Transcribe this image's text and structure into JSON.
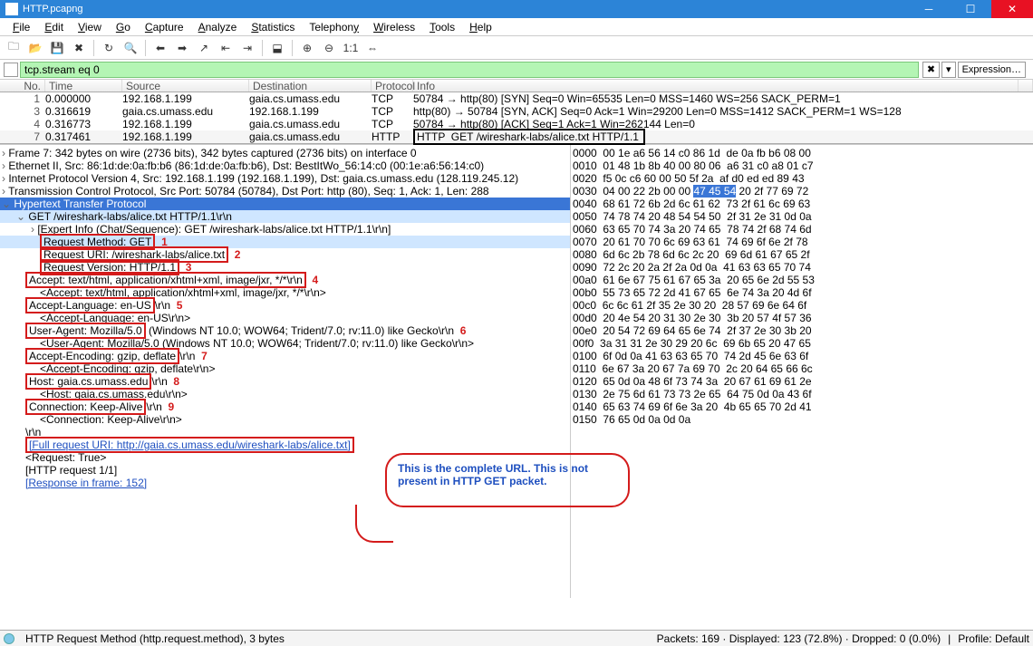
{
  "window": {
    "title": "HTTP.pcapng"
  },
  "menu": [
    "File",
    "Edit",
    "View",
    "Go",
    "Capture",
    "Analyze",
    "Statistics",
    "Telephony",
    "Wireless",
    "Tools",
    "Help"
  ],
  "filter": {
    "value": "tcp.stream eq 0",
    "expression_btn": "Expression…"
  },
  "columns": {
    "no": "No.",
    "time": "Time",
    "source": "Source",
    "dest": "Destination",
    "proto": "Protocol",
    "info": "Info"
  },
  "packets": [
    {
      "no": "1",
      "time": "0.000000",
      "src": "192.168.1.199",
      "dst": "gaia.cs.umass.edu",
      "proto": "TCP",
      "info": "50784 → http(80) [SYN] Seq=0 Win=65535 Len=0 MSS=1460 WS=256 SACK_PERM=1"
    },
    {
      "no": "3",
      "time": "0.316619",
      "src": "gaia.cs.umass.edu",
      "dst": "192.168.1.199",
      "proto": "TCP",
      "info": "http(80) → 50784 [SYN, ACK] Seq=0 Ack=1 Win=29200 Len=0 MSS=1412 SACK_PERM=1 WS=128"
    },
    {
      "no": "4",
      "time": "0.316773",
      "src": "192.168.1.199",
      "dst": "gaia.cs.umass.edu",
      "proto": "TCP",
      "info": "50784 → http(80) [ACK] Seq=1 Ack=1 Win=262144 Len=0"
    },
    {
      "no": "7",
      "time": "0.317461",
      "src": "192.168.1.199",
      "dst": "gaia.cs.umass.edu",
      "proto": "HTTP",
      "info": "GET /wireshark-labs/alice.txt HTTP/1.1 ",
      "boxed": true
    }
  ],
  "details": {
    "frame": "Frame 7: 342 bytes on wire (2736 bits), 342 bytes captured (2736 bits) on interface 0",
    "eth": "Ethernet II, Src: 86:1d:de:0a:fb:b6 (86:1d:de:0a:fb:b6), Dst: BestItWo_56:14:c0 (00:1e:a6:56:14:c0)",
    "ip": "Internet Protocol Version 4, Src: 192.168.1.199 (192.168.1.199), Dst: gaia.cs.umass.edu (128.119.245.12)",
    "tcp": "Transmission Control Protocol, Src Port: 50784 (50784), Dst Port: http (80), Seq: 1, Ack: 1, Len: 288",
    "http": "Hypertext Transfer Protocol",
    "get": "GET /wireshark-labs/alice.txt HTTP/1.1\\r\\n",
    "expert": "[Expert Info (Chat/Sequence): GET /wireshark-labs/alice.txt HTTP/1.1\\r\\n]",
    "method": "Request Method: GET",
    "uri": "Request URI: /wireshark-labs/alice.txt",
    "ver": "Request Version: HTTP/1.1",
    "accept": "Accept: text/html, application/xhtml+xml, image/jxr, */*\\r\\n",
    "accept_sub": "<Accept: text/html, application/xhtml+xml, image/jxr, */*\\r\\n>",
    "lang": "Accept-Language: en-US",
    "lang_tail": "\\r\\n",
    "lang_sub": "<Accept-Language: en-US\\r\\n>",
    "ua": "User-Agent: Mozilla/5.0",
    "ua_tail": " (Windows NT 10.0; WOW64; Trident/7.0; rv:11.0) like Gecko\\r\\n",
    "ua_sub": "<User-Agent: Mozilla/5.0 (Windows NT 10.0; WOW64; Trident/7.0; rv:11.0) like Gecko\\r\\n>",
    "enc": "Accept-Encoding: gzip, deflate",
    "enc_tail": "\\r\\n",
    "enc_sub": "<Accept-Encoding: gzip, deflate\\r\\n>",
    "host": "Host: gaia.cs.umass.edu",
    "host_tail": "\\r\\n",
    "host_sub": "<Host: gaia.cs.umass.edu\\r\\n>",
    "conn": "Connection: Keep-Alive",
    "conn_tail": "\\r\\n",
    "conn_sub": "<Connection: Keep-Alive\\r\\n>",
    "crlf": "\\r\\n",
    "full": "[Full request URI: http://gaia.cs.umass.edu/wireshark-labs/alice.txt]",
    "reqtrue": "<Request: True>",
    "req11": "[HTTP request 1/1]",
    "resp": "[Response in frame: 152]"
  },
  "annotations": {
    "n1": "1",
    "n2": "2",
    "n3": "3",
    "n4": "4",
    "n5": "5",
    "n6": "6",
    "n7": "7",
    "n8": "8",
    "n9": "9"
  },
  "callout": "This is the complete URL. This is not present in HTTP GET packet.",
  "hex": [
    "0000  00 1e a6 56 14 c0 86 1d  de 0a fb b6 08 00",
    "0010  01 48 1b 8b 40 00 80 06  a6 31 c0 a8 01 c7",
    "0020  f5 0c c6 60 00 50 5f 2a  af d0 ed ed 89 43",
    "0030  04 00 22 2b 00 00 47 45 54 20 2f 77 69 72",
    "0040  68 61 72 6b 2d 6c 61 62  73 2f 61 6c 69 63",
    "0050  74 78 74 20 48 54 54 50  2f 31 2e 31 0d 0a",
    "0060  63 65 70 74 3a 20 74 65  78 74 2f 68 74 6d",
    "0070  20 61 70 70 6c 69 63 61  74 69 6f 6e 2f 78",
    "0080  6d 6c 2b 78 6d 6c 2c 20  69 6d 61 67 65 2f",
    "0090  72 2c 20 2a 2f 2a 0d 0a  41 63 63 65 70 74",
    "00a0  61 6e 67 75 61 67 65 3a  20 65 6e 2d 55 53",
    "00b0  55 73 65 72 2d 41 67 65  6e 74 3a 20 4d 6f",
    "00c0  6c 6c 61 2f 35 2e 30 20  28 57 69 6e 64 6f",
    "00d0  20 4e 54 20 31 30 2e 30  3b 20 57 4f 57 36",
    "00e0  20 54 72 69 64 65 6e 74  2f 37 2e 30 3b 20",
    "00f0  3a 31 31 2e 30 29 20 6c  69 6b 65 20 47 65",
    "0100  6f 0d 0a 41 63 63 65 70  74 2d 45 6e 63 6f",
    "0110  6e 67 3a 20 67 7a 69 70  2c 20 64 65 66 6c",
    "0120  65 0d 0a 48 6f 73 74 3a  20 67 61 69 61 2e",
    "0130  2e 75 6d 61 73 73 2e 65  64 75 0d 0a 43 6f",
    "0140  65 63 74 69 6f 6e 3a 20  4b 65 65 70 2d 41",
    "0150  76 65 0d 0a 0d 0a"
  ],
  "status": {
    "left": "HTTP Request Method (http.request.method), 3 bytes",
    "packets": "Packets: 169 · Displayed: 123 (72.8%) · Dropped: 0 (0.0%)",
    "profile": "Profile: Default"
  }
}
